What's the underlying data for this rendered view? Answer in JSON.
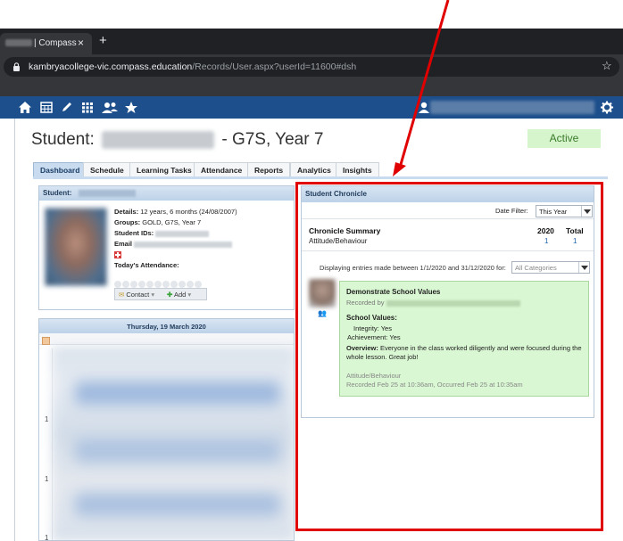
{
  "browser": {
    "tab_title": "| Compass",
    "tab_close": "×",
    "new_tab": "+",
    "url_host": "kambryacollege-vic.compass.education",
    "url_path": "/Records/User.aspx?userId=11600#dsh",
    "icons": [
      "lock-icon",
      "star-icon",
      "kebab-menu-icon"
    ]
  },
  "navbar": {
    "icons": [
      "home-icon",
      "calendar-icon",
      "pencil-icon",
      "grid-icon",
      "people-icon",
      "star-icon",
      "user-icon",
      "gear-icon"
    ]
  },
  "header": {
    "title_prefix": "Student:",
    "title_suffix": "- G7S, Year 7",
    "status": "Active"
  },
  "tabs": [
    "Dashboard",
    "Schedule",
    "Learning Tasks",
    "Attendance",
    "Reports",
    "Analytics",
    "Insights"
  ],
  "student_box": {
    "header": "Student:",
    "details_label": "Details:",
    "details_value": "12 years, 6 months (24/08/2007)",
    "groups_label": "Groups:",
    "groups_value": "GOLD, G7S, Year 7",
    "ids_label": "Student IDs:",
    "email_label": "Email",
    "attendance_label": "Today's Attendance:",
    "contact_button": "Contact",
    "add_button": "Add"
  },
  "calendar": {
    "date": "Thursday, 19 March 2020",
    "time_labels": [
      "1",
      "1",
      "1"
    ]
  },
  "chronicle": {
    "header": "Student Chronicle",
    "date_filter_label": "Date Filter:",
    "date_filter_value": "This Year",
    "summary_title": "Chronicle Summary",
    "col_year": "2020",
    "col_total": "Total",
    "category": "Attitude/Behaviour",
    "count_year": "1",
    "count_total": "1",
    "display_text": "Displaying entries made between 1/1/2020 and 31/12/2020 for:",
    "category_filter": "All Categories",
    "entry": {
      "title": "Demonstrate School Values",
      "recorded_by": "Recorded by",
      "values_heading": "School Values:",
      "value_1": "Integrity: Yes",
      "value_2": "Achievement: Yes",
      "overview_label": "Overview:",
      "overview_text": "Everyone in the class worked diligently and were focused during the whole lesson. Great job!",
      "category": "Attitude/Behaviour",
      "timestamp": "Recorded Feb 25 at 10:36am, Occurred Feb 25 at 10:35am"
    }
  },
  "colors": {
    "nav": "#1d4f8c",
    "entry_bg": "#d9f7d2",
    "badge_bg": "#d6f5cc",
    "annotation": "#e00000"
  }
}
